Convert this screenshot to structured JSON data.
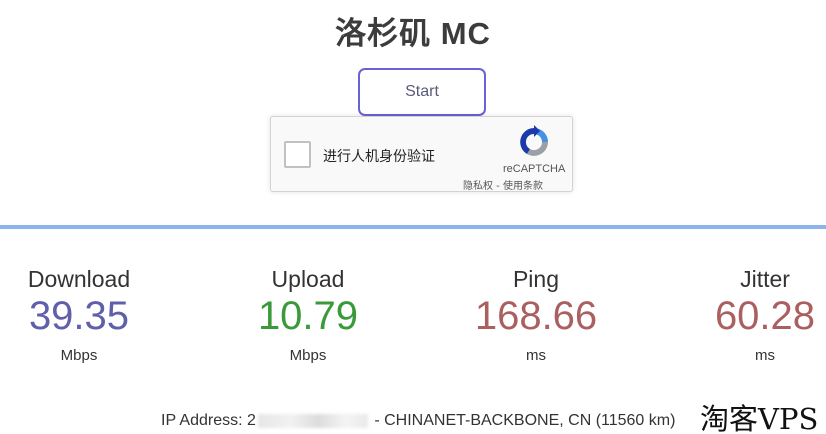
{
  "header": {
    "title": "洛杉矶 MC"
  },
  "controls": {
    "start_label": "Start"
  },
  "captcha": {
    "checkbox_label": "进行人机身份验证",
    "brand": "reCAPTCHA",
    "privacy_link": "隐私权",
    "separator": " - ",
    "terms_link": "使用条款"
  },
  "metrics": [
    {
      "label": "Download",
      "value": "39.35",
      "unit": "Mbps",
      "color": "#6060aa"
    },
    {
      "label": "Upload",
      "value": "10.79",
      "unit": "Mbps",
      "color": "#3a9a3a"
    },
    {
      "label": "Ping",
      "value": "168.66",
      "unit": "ms",
      "color": "#aa6060"
    },
    {
      "label": "Jitter",
      "value": "60.28",
      "unit": "ms",
      "color": "#aa6060"
    }
  ],
  "footer": {
    "ip_prefix": "IP Address: 2",
    "ip_suffix": "- CHINANET-BACKBONE, CN (11560 km)"
  },
  "watermark": "淘客VPS",
  "colors": {
    "accent": "#6a61d4",
    "divider": "#8cb4ea"
  }
}
